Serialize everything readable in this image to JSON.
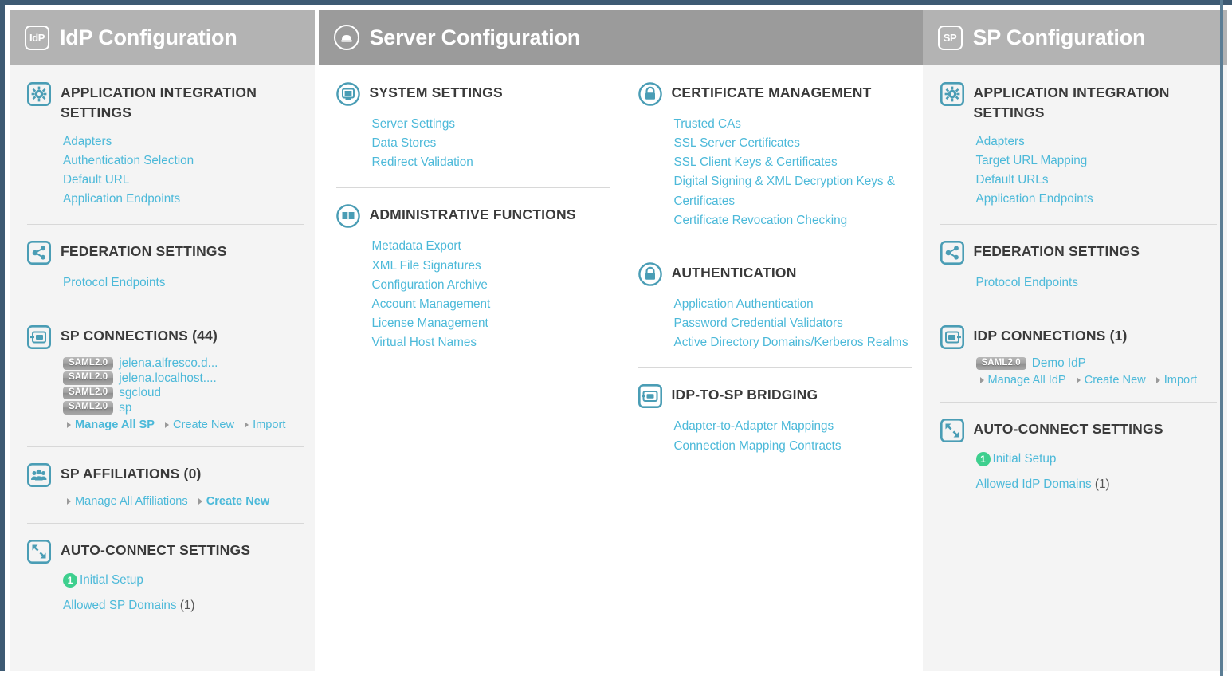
{
  "columns": {
    "idp": {
      "header": {
        "icon": "idp-badge-icon",
        "badge_text": "IdP",
        "title": "IdP Configuration"
      },
      "sections": [
        {
          "icon": "gear-icon",
          "title": "APPLICATION INTEGRATION SETTINGS",
          "links": [
            "Adapters",
            "Authentication Selection",
            "Default URL",
            "Application Endpoints"
          ]
        },
        {
          "icon": "share-icon",
          "title": "FEDERATION SETTINGS",
          "links": [
            "Protocol Endpoints"
          ]
        },
        {
          "icon": "connection-icon",
          "title": "SP CONNECTIONS (44)",
          "connections": [
            {
              "protocol": "SAML2.0",
              "name": "jelena.alfresco.d..."
            },
            {
              "protocol": "SAML2.0",
              "name": "jelena.localhost...."
            },
            {
              "protocol": "SAML2.0",
              "name": "sgcloud"
            },
            {
              "protocol": "SAML2.0",
              "name": "sp"
            }
          ],
          "actions": [
            {
              "label": "Manage All SP",
              "bold": true
            },
            {
              "label": "Create New",
              "bold": false
            },
            {
              "label": "Import",
              "bold": false
            }
          ]
        },
        {
          "icon": "people-icon",
          "title": "SP AFFILIATIONS (0)",
          "actions": [
            {
              "label": "Manage All Affiliations",
              "bold": false
            },
            {
              "label": "Create New",
              "bold": true
            }
          ]
        },
        {
          "icon": "exchange-icon",
          "title": "AUTO-CONNECT SETTINGS",
          "setup": {
            "badge": "1",
            "label": "Initial Setup"
          },
          "domains": {
            "label": "Allowed SP Domains",
            "count": "(1)"
          }
        }
      ]
    },
    "server": {
      "header": {
        "icon": "server-circle-icon",
        "title": "Server Configuration"
      },
      "left_sections": [
        {
          "icon": "monitor-icon",
          "title": "SYSTEM SETTINGS",
          "links": [
            "Server Settings",
            "Data Stores",
            "Redirect Validation"
          ]
        },
        {
          "icon": "book-icon",
          "title": "ADMINISTRATIVE FUNCTIONS",
          "links": [
            "Metadata Export",
            "XML File Signatures",
            "Configuration Archive",
            "Account Management",
            "License Management",
            "Virtual Host Names"
          ]
        }
      ],
      "right_sections": [
        {
          "icon": "lock-icon",
          "title": "CERTIFICATE MANAGEMENT",
          "links": [
            "Trusted CAs",
            "SSL Server Certificates",
            "SSL Client Keys & Certificates",
            "Digital Signing & XML Decryption Keys & Certificates",
            "Certificate Revocation Checking"
          ]
        },
        {
          "icon": "lock-icon",
          "title": "AUTHENTICATION",
          "links": [
            "Application Authentication",
            "Password Credential Validators",
            "Active Directory Domains/Kerberos Realms"
          ]
        },
        {
          "icon": "bridge-icon",
          "title": "IDP-TO-SP BRIDGING",
          "links": [
            "Adapter-to-Adapter Mappings",
            "Connection Mapping Contracts"
          ]
        }
      ]
    },
    "sp": {
      "header": {
        "icon": "sp-badge-icon",
        "badge_text": "SP",
        "title": "SP Configuration"
      },
      "sections": [
        {
          "icon": "gear-icon",
          "title": "APPLICATION INTEGRATION SETTINGS",
          "links": [
            "Adapters",
            "Target URL Mapping",
            "Default URLs",
            "Application Endpoints"
          ]
        },
        {
          "icon": "share-icon",
          "title": "FEDERATION SETTINGS",
          "links": [
            "Protocol Endpoints"
          ]
        },
        {
          "icon": "connection-icon",
          "title": "IDP CONNECTIONS (1)",
          "connections": [
            {
              "protocol": "SAML2.0",
              "name": "Demo IdP"
            }
          ],
          "actions": [
            {
              "label": "Manage All IdP",
              "bold": false
            },
            {
              "label": "Create New",
              "bold": false
            },
            {
              "label": "Import",
              "bold": false
            }
          ]
        },
        {
          "icon": "exchange-icon",
          "title": "AUTO-CONNECT SETTINGS",
          "setup": {
            "badge": "1",
            "label": "Initial Setup"
          },
          "domains": {
            "label": "Allowed IdP Domains",
            "count": "(1)"
          }
        }
      ]
    }
  },
  "colors": {
    "link": "#4cb9d9",
    "icon_teal": "#4a9db5",
    "header_side": "#b3b3b3",
    "header_center": "#9b9b9b",
    "body_side": "#f4f4f4",
    "body_center": "#ffffff",
    "badge_green": "#3ecf8e",
    "frame": "#3d5a73"
  }
}
